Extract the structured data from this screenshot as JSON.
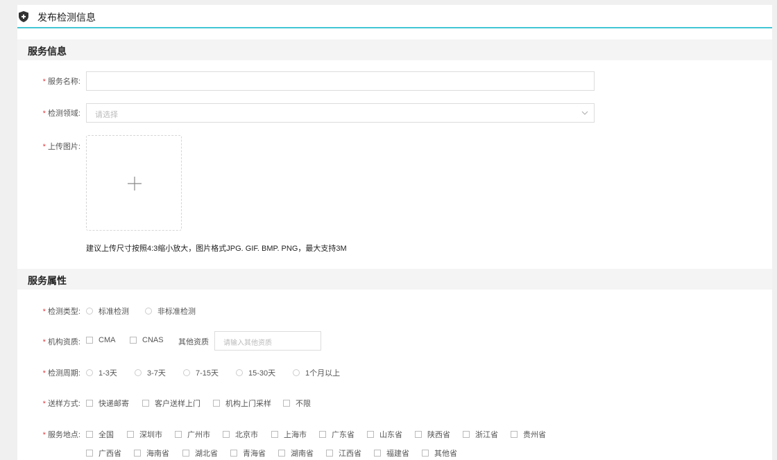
{
  "page": {
    "title": "发布检测信息"
  },
  "sections": {
    "service_info": "服务信息",
    "service_attrs": "服务属性"
  },
  "form": {
    "service_name_label": "服务名称:",
    "field_label": "检测领域:",
    "field_placeholder": "请选择",
    "upload_label": "上传图片:",
    "upload_hint": "建议上传尺寸按照4:3缩小放大，图片格式JPG. GIF. BMP. PNG，最大支持3M",
    "detect_type_label": "检测类型:",
    "detect_types": [
      "标准检测",
      "非标准检测"
    ],
    "qualification_label": "机构资质:",
    "qualifications": [
      "CMA",
      "CNAS"
    ],
    "other_qual_label": "其他资质",
    "other_qual_placeholder": "请输入其他资质",
    "cycle_label": "检测周期:",
    "cycles": [
      "1-3天",
      "3-7天",
      "7-15天",
      "15-30天",
      "1个月以上"
    ],
    "delivery_label": "送样方式:",
    "deliveries": [
      "快递邮寄",
      "客户送样上门",
      "机构上门采样",
      "不限"
    ],
    "location_label": "服务地点:",
    "locations_row1": [
      "全国",
      "深圳市",
      "广州市",
      "北京市",
      "上海市",
      "广东省",
      "山东省",
      "陕西省",
      "浙江省",
      "贵州省"
    ],
    "locations_row2": [
      "广西省",
      "海南省",
      "湖北省",
      "青海省",
      "湖南省",
      "江西省",
      "福建省",
      "其他省"
    ]
  },
  "colors": {
    "accent": "#3fc6d4",
    "required": "#e4393c"
  },
  "icons": {
    "header": "shield-icon",
    "upload": "plus-icon",
    "select": "chevron-down-icon"
  }
}
